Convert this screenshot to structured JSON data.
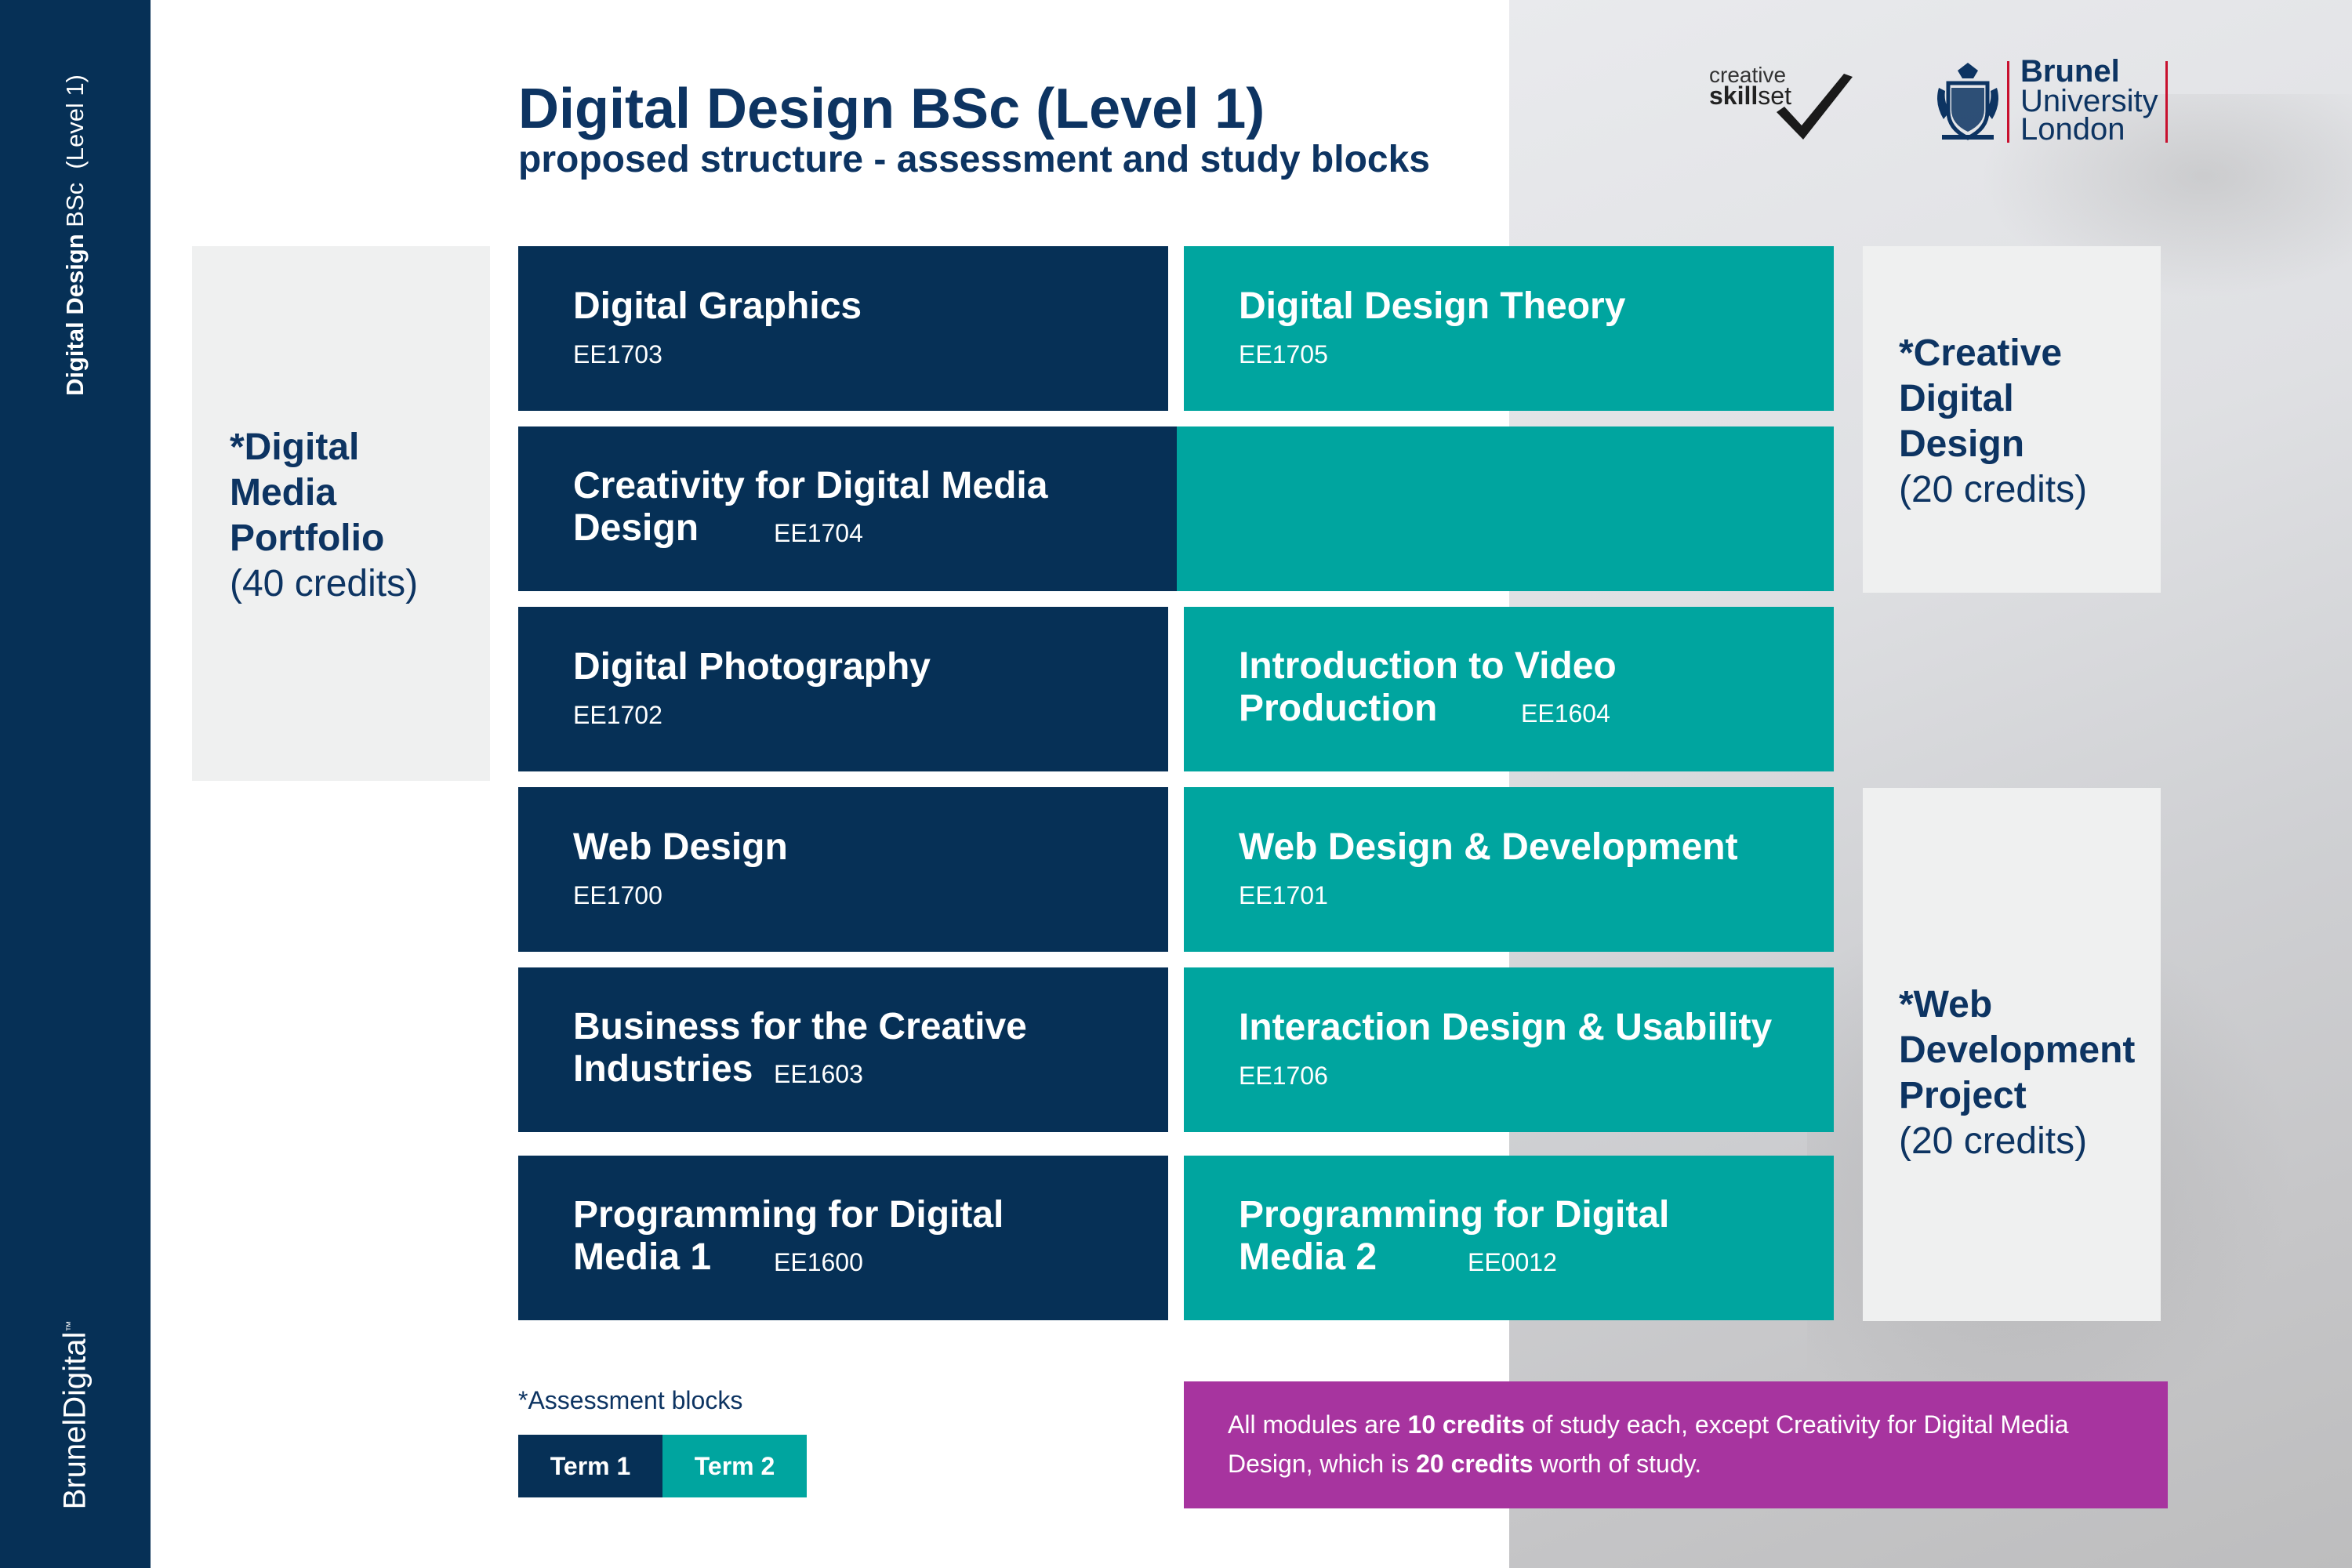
{
  "sidebar": {
    "title_bold": "Digital Design",
    "title_regular": " BSc  (Level 1)",
    "brand_a": "Brunel",
    "brand_b": "Digital",
    "brand_tm": "™"
  },
  "header": {
    "title": "Digital Design BSc (Level 1)",
    "subtitle": "proposed structure - assessment and study blocks"
  },
  "logos": {
    "skillset_word1": "creative",
    "skillset_word2_bold": "skill",
    "skillset_word2_rest": "set",
    "brunel_name": "Brunel",
    "brunel_university": "University",
    "brunel_london": "London"
  },
  "assessment_blocks": [
    {
      "title": "*Digital\nMedia\nPortfolio",
      "credits": "(40 credits)"
    },
    {
      "title": "*Creative\nDigital\nDesign",
      "credits": "(20 credits)"
    },
    {
      "title": "*Web\nDevelopment\nProject",
      "credits": "(20 credits)"
    }
  ],
  "term1_modules": [
    {
      "title": "Digital Graphics",
      "code": "EE1703"
    },
    {
      "title": "Creativity for Digital Media",
      "title_line2": "Design",
      "code": "EE1704"
    },
    {
      "title": "Digital Photography",
      "code": "EE1702"
    },
    {
      "title": "Web Design",
      "code": "EE1700"
    },
    {
      "title": "Business for the Creative",
      "title_line2": "Industries",
      "code": "EE1603"
    },
    {
      "title": "Programming for Digital",
      "title_line2": "Media 1",
      "code": "EE1600"
    }
  ],
  "term2_modules": [
    {
      "title": "Digital Design Theory",
      "code": "EE1705"
    },
    {
      "title": "Introduction to Video",
      "title_line2": "Production",
      "code": "EE1604"
    },
    {
      "title": "Web Design & Development",
      "code": "EE1701"
    },
    {
      "title": "Interaction Design & Usability",
      "code": "EE1706"
    },
    {
      "title": "Programming for Digital",
      "title_line2": "Media 2",
      "code": "EE0012"
    }
  ],
  "legend": {
    "label": "*Assessment blocks",
    "term1": "Term 1",
    "term2": "Term 2"
  },
  "note": {
    "part1": "All modules are ",
    "bold1": "10 credits",
    "part2": " of study each, except Creativity for Digital Media Design, which is ",
    "bold2": "20 credits",
    "part3": " worth of study."
  },
  "colors": {
    "navy": "#063056",
    "teal": "#00a59f",
    "assessment_bg": "#eff0f0",
    "note_bg": "#a7349f",
    "brunel_red": "#c8102e"
  }
}
